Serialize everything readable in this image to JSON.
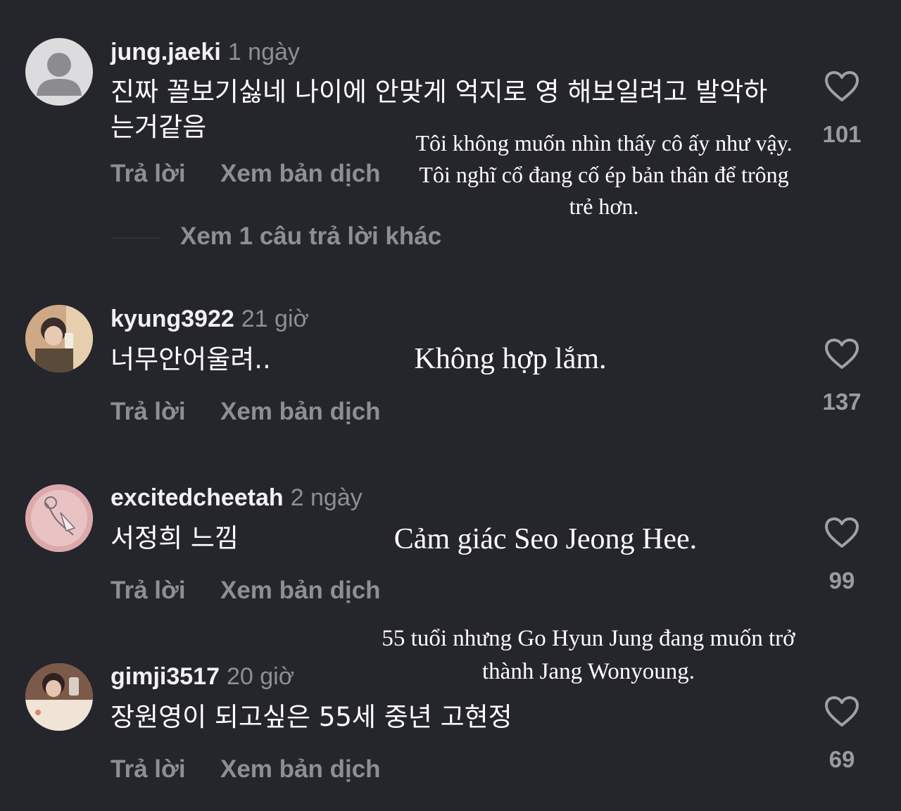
{
  "comments": [
    {
      "username": "jung.jaeki",
      "time": "1 ngày",
      "text": "진짜 꼴보기싫네 나이에 안맞게 억지로 영 해보일려고 발악하는거같음",
      "reply_label": "Trả lời",
      "translate_label": "Xem bản dịch",
      "likes": "101",
      "more_replies": "Xem 1 câu trả lời khác",
      "translation": "Tôi không muốn nhìn thấy cô ấy như vậy. Tôi nghĩ cổ đang cố ép bản thân để trông trẻ hơn."
    },
    {
      "username": "kyung3922",
      "time": "21 giờ",
      "text": "너무안어울려..",
      "reply_label": "Trả lời",
      "translate_label": "Xem bản dịch",
      "likes": "137",
      "translation": "Không hợp lắm."
    },
    {
      "username": "excitedcheetah",
      "time": "2 ngày",
      "text": "서정희 느낌",
      "reply_label": "Trả lời",
      "translate_label": "Xem bản dịch",
      "likes": "99",
      "translation": "Cảm giác Seo Jeong Hee."
    },
    {
      "username": "gimji3517",
      "time": "20 giờ",
      "text": "장원영이 되고싶은 55세 중년 고현정",
      "reply_label": "Trả lời",
      "translate_label": "Xem bản dịch",
      "likes": "69",
      "translation": "55 tuổi nhưng Go Hyun Jung đang muốn trở thành Jang Wonyoung."
    }
  ],
  "colors": {
    "background": "#25252c",
    "secondary_text": "#8e8e96",
    "primary_text": "#ffffff"
  },
  "icons": [
    "heart-icon",
    "default-avatar-icon"
  ]
}
